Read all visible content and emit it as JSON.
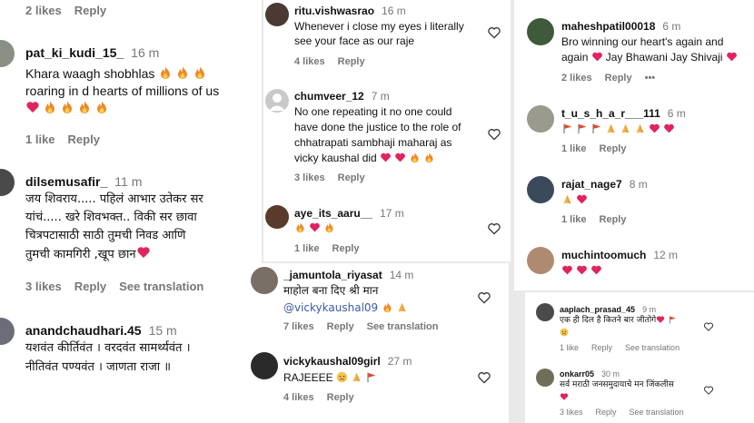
{
  "p1": {
    "top_meta": {
      "likes": "2 likes",
      "reply": "Reply"
    },
    "c1": {
      "user": "pat_ki_kudi_15_",
      "time": "16 m",
      "text": "Khara waagh shobhlas",
      "text2": "roaring in d hearts of millions of us",
      "likes": "1 like",
      "reply": "Reply"
    },
    "c2": {
      "user": "dilsemusafir_",
      "time": "11 m",
      "l1": "जय शिवराय..... पहिलं आभार उतेकर सर",
      "l2": "यांचं..... खरे शिवभक्त.. विकी सर छावा",
      "l3": "चित्रपटासाठी साठी तुमची निवड आणि",
      "l4": "तुमची कामगिरी ,खूप छान",
      "likes": "3 likes",
      "reply": "Reply",
      "translate": "See translation"
    },
    "c3": {
      "user": "anandchaudhari.45",
      "time": "15 m",
      "l1": "यशवंत कीर्तिवंत । वरदवंत सामर्थ्यवंत ।",
      "l2": "नीतिवंत पण्यवंत । जाणता राजा ॥"
    }
  },
  "p2": {
    "c1": {
      "user": "ritu.vishwasrao",
      "time": "16 m",
      "l1": "Whenever i close my eyes i literally",
      "l2": "see your face as our raje",
      "likes": "4 likes",
      "reply": "Reply"
    },
    "c2": {
      "user": "chumveer_12",
      "time": "7 m",
      "l1": "No one repeating it no one could",
      "l2": "have done the justice to the role of",
      "l3": "chhatrapati sambhaji maharaj as",
      "l4": "vicky kaushal did",
      "likes": "3 likes",
      "reply": "Reply"
    },
    "c3": {
      "user": "aye_its_aaru__",
      "time": "17 m",
      "likes": "1 like",
      "reply": "Reply"
    }
  },
  "p3": {
    "c1": {
      "user": "_jamuntola_riyasat",
      "time": "14 m",
      "l1": "माहोल बना दिए श्री मान",
      "mention": "@vickykaushal09",
      "likes": "7 likes",
      "reply": "Reply",
      "translate": "See translation"
    },
    "c2": {
      "user": "vickykaushal09girl",
      "time": "27 m",
      "text": "RAJEEEE",
      "likes": "4 likes",
      "reply": "Reply"
    }
  },
  "p4": {
    "c1": {
      "user": "maheshpatil00018",
      "time": "6 m",
      "l1": "Bro winning our heart's again and",
      "l2a": "again",
      "l2b": "Jay Bhawani Jay Shivaji",
      "likes": "2 likes",
      "reply": "Reply",
      "more": "•••"
    },
    "c2": {
      "user": "t_u_s_h_a_r___111",
      "time": "6 m",
      "likes": "1 like",
      "reply": "Reply"
    },
    "c3": {
      "user": "rajat_nage7",
      "time": "8 m",
      "likes": "1 like",
      "reply": "Reply"
    },
    "c4": {
      "user": "muchintoomuch",
      "time": "12 m"
    }
  },
  "p5": {
    "c1": {
      "user": "aaplach_prasad_45",
      "time": "9 m",
      "text": "एक ही दिल है कितने बार जीतोगे",
      "likes": "1 like",
      "reply": "Reply",
      "translate": "See translation"
    },
    "c2": {
      "user": "onkarr05",
      "time": "30 m",
      "text": "सर्व मराठी जनसमुदायाचे मन जिंकलीस",
      "likes": "3 likes",
      "reply": "Reply",
      "translate": "See translation"
    }
  },
  "colors": {
    "fire": "#f0862a",
    "heart": "#e0245e",
    "flag": "#e8452c",
    "meta": "#777777",
    "link": "#3e5aa8"
  }
}
